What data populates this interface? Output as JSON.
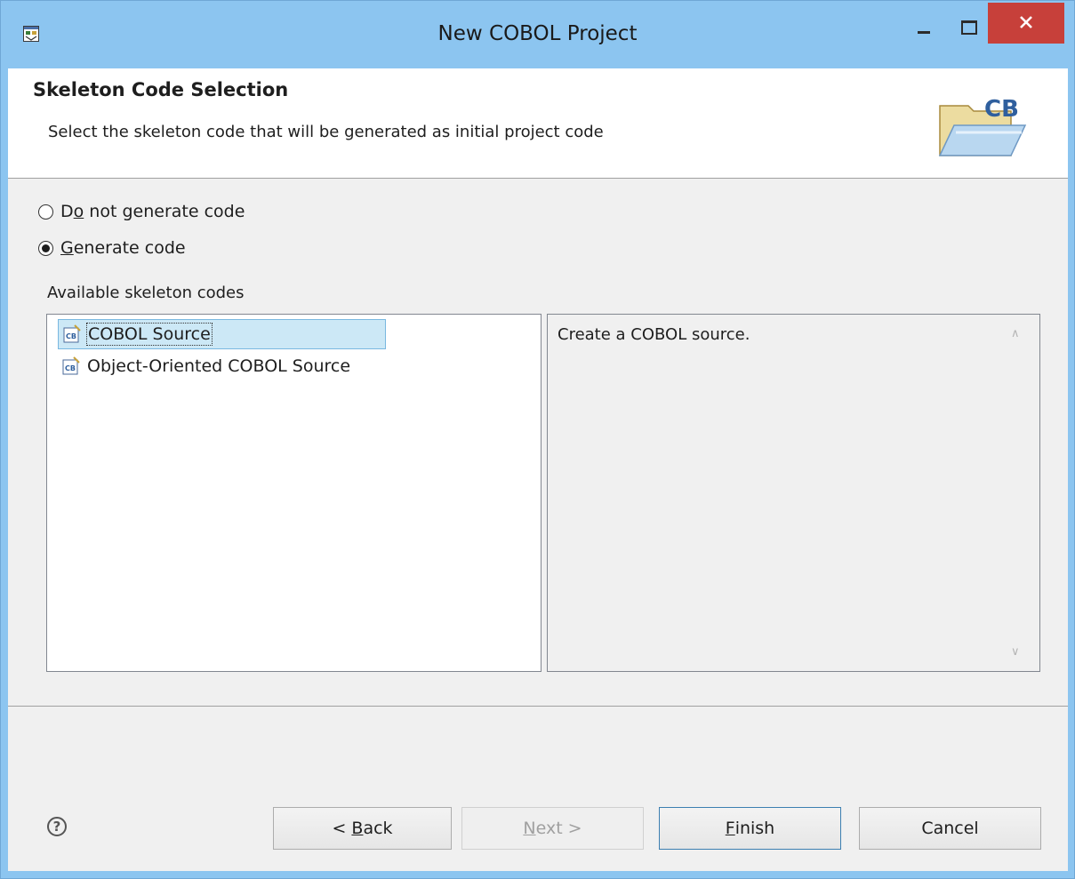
{
  "window": {
    "title": "New COBOL Project",
    "accent": "#8cc5f0",
    "close_color": "#c7403a"
  },
  "banner": {
    "title": "Skeleton Code Selection",
    "subtitle": "Select the skeleton code that will be generated as initial project code",
    "logo_text": "CB"
  },
  "options": {
    "no_code": {
      "pre": "D",
      "mnemonic": "o",
      "post": " not generate code",
      "checked": false
    },
    "gen_code": {
      "pre": "",
      "mnemonic": "G",
      "post": "enerate code",
      "checked": true
    }
  },
  "skeletons": {
    "label": "Available skeleton codes",
    "items": [
      {
        "label": "COBOL Source",
        "icon": "cobol-source-icon",
        "selected": true
      },
      {
        "label": "Object-Oriented COBOL Source",
        "icon": "cobol-source-icon",
        "selected": false
      }
    ]
  },
  "description": {
    "text": "Create a COBOL source."
  },
  "buttons": {
    "help": "?",
    "back": {
      "pre": "< ",
      "mnemonic": "B",
      "post": "ack"
    },
    "next": {
      "pre": "",
      "mnemonic": "N",
      "post": "ext >",
      "disabled": true
    },
    "finish": {
      "pre": "",
      "mnemonic": "F",
      "post": "inish"
    },
    "cancel": "Cancel"
  }
}
